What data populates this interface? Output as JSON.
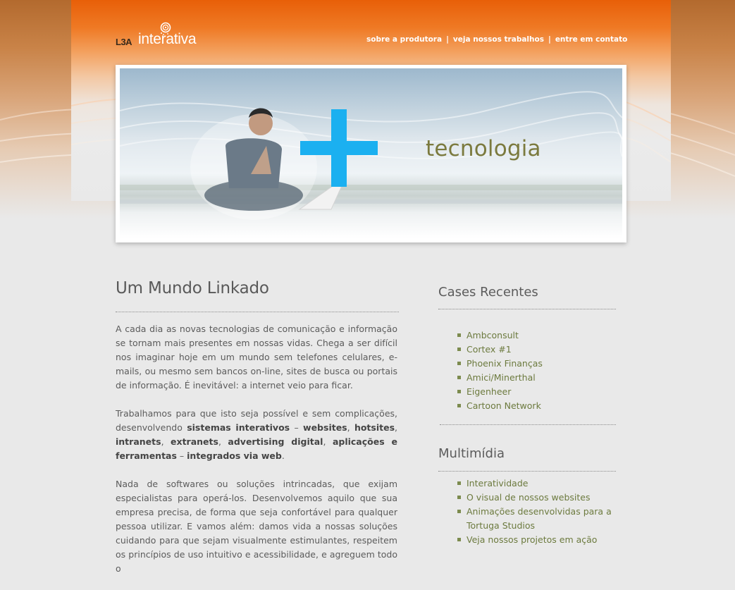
{
  "brand": {
    "prefix": "L3A",
    "name": "interativa",
    "colors": {
      "orange": "#ec6a10",
      "accent_green": "#6c7a3e",
      "plus_blue": "#1bb0f0"
    }
  },
  "nav": {
    "items": [
      {
        "label": "sobre a produtora"
      },
      {
        "label": "veja nossos trabalhos"
      },
      {
        "label": "entre em  contato"
      }
    ],
    "separator": "|"
  },
  "banner": {
    "tagline": "tecnologia",
    "plus_icon": "plus-icon"
  },
  "main": {
    "title": "Um Mundo Linkado",
    "p1": "A cada dia as novas tecnologias de comunicação e informação se tornam mais presentes em nossas vidas. Chega a ser difícil nos imaginar hoje em um mundo sem telefones celulares, e-mails, ou mesmo sem bancos on-line, sites de busca ou portais de informação. É inevitável: a internet veio para ficar.",
    "p2": {
      "t1": "Trabalhamos para que isto seja possível e sem complicações, desenvolvendo ",
      "b1": "sistemas interativos",
      "t2": " – ",
      "b2": "websites",
      "t3": ", ",
      "b3": "hotsites",
      "t4": ", ",
      "b4": "intranets",
      "t5": ", ",
      "b5": "extranets",
      "t6": ", ",
      "b6": "advertising digital",
      "t7": ", ",
      "b7": "aplicações e ferramentas",
      "t8": " – ",
      "b8": "integrados via web",
      "t9": "."
    },
    "p3": "Nada de softwares ou soluções intrincadas, que exijam especialistas para operá-los. Desenvolvemos aquilo que sua empresa precisa, de forma que seja confortável para qualquer pessoa utilizar. E vamos além: damos vida a nossas soluções cuidando para que sejam visualmente estimulantes, respeitem os princípios de uso intuitivo e acessibilidade, e agreguem todo o"
  },
  "sidebar": {
    "cases_title": "Cases Recentes",
    "cases": [
      "Ambconsult",
      "Cortex #1",
      "Phoenix Finanças",
      "Amici/Minerthal",
      "Eigenheer",
      "Cartoon Network"
    ],
    "multimedia_title": "Multimídia",
    "multimedia": [
      "Interatividade",
      "O visual de nossos websites",
      "Animações desenvolvidas para a Tortuga Studios",
      "Veja nossos projetos em ação"
    ]
  }
}
